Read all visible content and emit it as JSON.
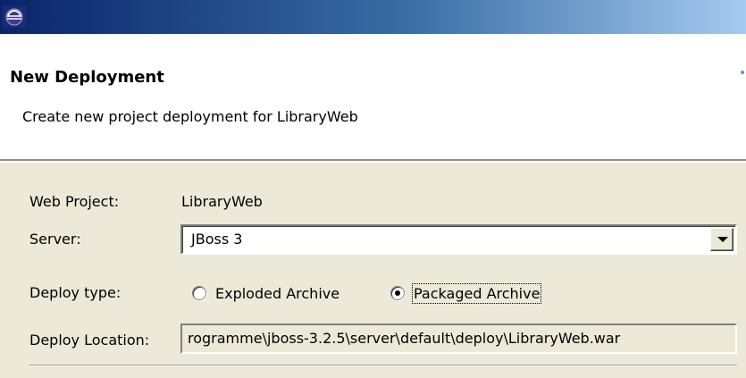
{
  "window": {
    "icon": "eclipse-icon"
  },
  "banner": {
    "title": "New Deployment",
    "message": "Create new project deployment for LibraryWeb"
  },
  "form": {
    "web_project": {
      "label": "Web Project:",
      "value": "LibraryWeb"
    },
    "server": {
      "label": "Server:",
      "selected": "JBoss 3"
    },
    "deploy_type": {
      "label": "Deploy type:",
      "options": [
        {
          "label": "Exploded Archive",
          "selected": false
        },
        {
          "label": "Packaged Archive",
          "selected": true
        }
      ]
    },
    "deploy_location": {
      "label": "Deploy Location:",
      "value": "rogramme\\jboss-3.2.5\\server\\default\\deploy\\LibraryWeb.war"
    }
  },
  "colors": {
    "titlebar_start": "#0a246a",
    "titlebar_end": "#a6caf0",
    "dialog_background": "#ece9d8"
  }
}
